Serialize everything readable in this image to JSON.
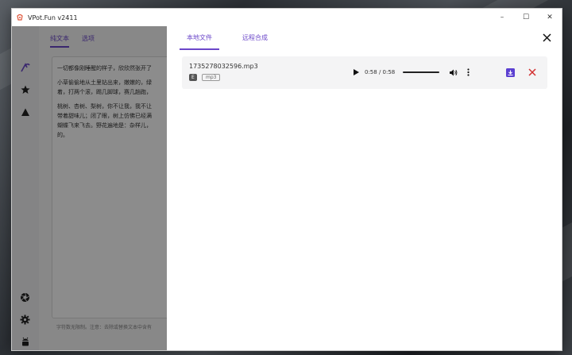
{
  "window": {
    "title": "VPot.Fun v2411",
    "controls": {
      "minimize": "–",
      "maximize": "☐",
      "close": "✕"
    }
  },
  "rail": {
    "items": [
      {
        "name": "tts-icon"
      },
      {
        "name": "star-icon"
      },
      {
        "name": "triangle-icon"
      },
      {
        "name": "aperture-icon"
      },
      {
        "name": "gear-icon"
      },
      {
        "name": "android-icon"
      }
    ]
  },
  "background": {
    "tabs": [
      "纯文本",
      "选项"
    ],
    "paragraphs": [
      "一切都像刚睡醒的样子，欣欣然张开了",
      "小草偷偷地从土里钻出来，嫩嫩的，绿",
      "着，打两个滚，踢几脚球，赛几趟跑，",
      "桃树、杏树、梨树，你不让我，我不让",
      "带着甜味儿；闭了眼，树上仿佛已经满",
      "蝴蝶飞来飞去。野花遍地是：杂样儿，",
      "的。"
    ],
    "footnote": "字符数无限制。注意：去除或替换文本中含有"
  },
  "drawer": {
    "tabs": [
      "本地文件",
      "远程合成"
    ],
    "active_tab": "本地文件",
    "close_icon": "close-icon",
    "files": [
      {
        "name": "1735278032596.mp3",
        "badge": "E",
        "format": "mp3",
        "time": "0:58 / 0:58",
        "progress": 1.0
      }
    ]
  },
  "colors": {
    "accent": "#6b47c9",
    "delete": "#d32f2f",
    "save": "#5b3fd1"
  }
}
